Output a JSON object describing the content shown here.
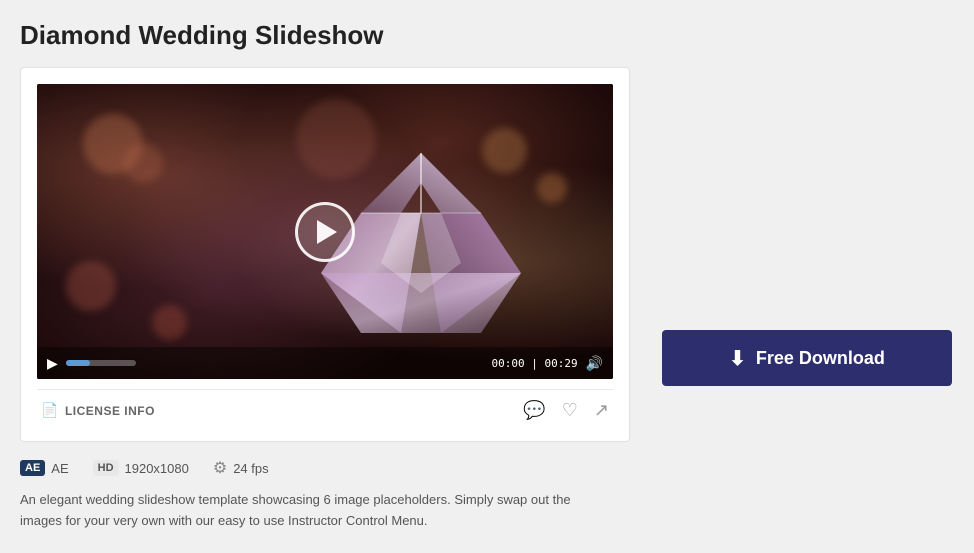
{
  "title": "Diamond Wedding Slideshow",
  "video": {
    "duration": "00:29",
    "current_time": "00:00",
    "time_display": "00:00 | 00:29"
  },
  "controls": {
    "license_label": "LICENSE INFO",
    "play_label": "▶"
  },
  "meta": {
    "app_badge": "AE",
    "app_label": "AE",
    "resolution_badge": "HD",
    "resolution": "1920x1080",
    "fps": "24 fps"
  },
  "description": "An elegant wedding slideshow template showcasing 6 image placeholders. Simply swap out the images for your very own with our easy to use Instructor Control Menu.",
  "download": {
    "label": "Free Download"
  },
  "icons": {
    "download": "⬇",
    "comment": "💬",
    "heart": "♡",
    "share": "↗",
    "volume": "🔊",
    "license_file": "📄",
    "fps_icon": "⚙"
  }
}
